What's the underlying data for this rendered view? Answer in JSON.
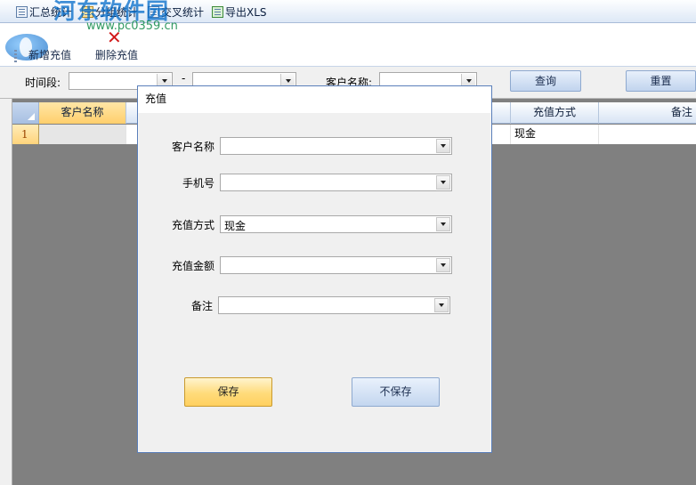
{
  "menu": {
    "items": [
      {
        "label": "汇总统计",
        "icon": "summary-report-icon"
      },
      {
        "label": "分组统计",
        "icon": "group-report-icon"
      },
      {
        "label": "交叉统计",
        "icon": "cross-report-icon"
      },
      {
        "label": "导出XLS",
        "icon": "export-xls-icon"
      }
    ]
  },
  "toolbar": {
    "add_label": "新增充值",
    "delete_label": "删除充值"
  },
  "watermark": {
    "text": "河东软件园",
    "url": "www.pc0359.cn"
  },
  "filter": {
    "period_label": "时间段:",
    "separator": "-",
    "start_value": "",
    "end_value": "",
    "customer_label": "客户名称:",
    "customer_value": "",
    "search_label": "查询",
    "reset_label": "重置"
  },
  "grid": {
    "columns": [
      "客户名称",
      "充值方式",
      "备注"
    ],
    "rows": [
      {
        "row_number": "1",
        "customer": "",
        "method": "现金",
        "note": ""
      }
    ]
  },
  "dialog": {
    "title": "充值",
    "fields": {
      "customer_label": "客户名称",
      "customer_value": "",
      "phone_label": "手机号",
      "phone_value": "",
      "method_label": "充值方式",
      "method_value": "现金",
      "amount_label": "充值金额",
      "amount_value": "",
      "note_label": "备注",
      "note_value": ""
    },
    "save_label": "保存",
    "nosave_label": "不保存"
  },
  "colors": {
    "accent_orange": "#ffd060",
    "accent_blue": "#c3d6ef",
    "dialog_border": "#5a7fba"
  }
}
